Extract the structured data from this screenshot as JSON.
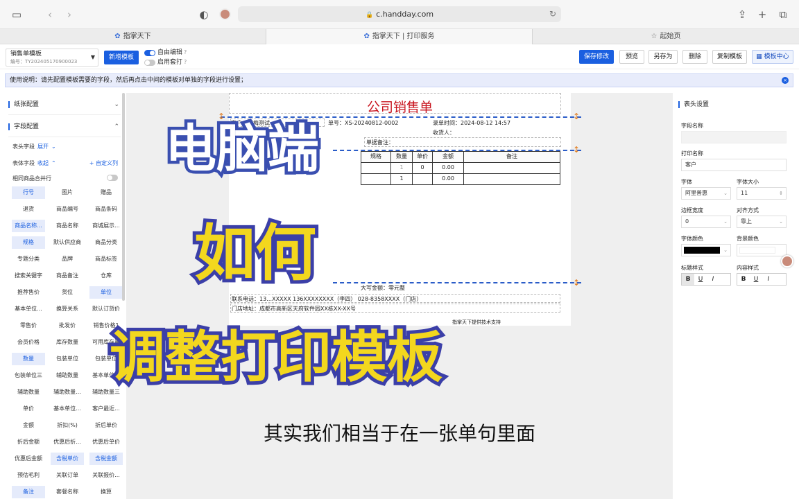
{
  "browser": {
    "url": "c.handday.com"
  },
  "tabs": [
    {
      "label": "指掌天下"
    },
    {
      "label": "指掌天下 | 打印服务"
    },
    {
      "label": "起始页"
    }
  ],
  "toolbar": {
    "template_name": "销售单模板",
    "template_code": "编号：TY202405170900023",
    "new_template": "新增模板",
    "free_edit": "自由编辑",
    "enable_set_print": "启用套打",
    "save": "保存修改",
    "preview": "预览",
    "save_as": "另存为",
    "delete": "删除",
    "copy": "复制模板",
    "center": "模板中心"
  },
  "notice": "使用说明：请先配置模板需要的字段，然后再点击中间的模板对单独的字段进行设置；",
  "left": {
    "paper_config": "纸张配置",
    "field_config": "字段配置",
    "header_fields": "表头字段",
    "expand": "展开",
    "table_fields": "表体字段",
    "collapse": "收起",
    "custom": "+ 自定义列",
    "merge_rows": "相同商品合并行",
    "chips": [
      [
        "行号",
        "图片",
        "赠品"
      ],
      [
        "退货",
        "商品编号",
        "商品条码"
      ],
      [
        "商品名称...",
        "商品名称",
        "商城展示..."
      ],
      [
        "规格",
        "默认供应商",
        "商品分类"
      ],
      [
        "专题分类",
        "品牌",
        "商品标签"
      ],
      [
        "搜索关键字",
        "商品备注",
        "仓库"
      ],
      [
        "推荐售价",
        "货位",
        "单位"
      ],
      [
        "基本单位...",
        "换算关系",
        "默认订货价"
      ],
      [
        "零售价",
        "批发价",
        "销售价格1"
      ],
      [
        "会员价格",
        "库存数量",
        "可用库存量"
      ],
      [
        "数量",
        "包装单位",
        "包装单位"
      ],
      [
        "包装单位三",
        "辅助数量",
        "基本单位..."
      ],
      [
        "辅助数量",
        "辅助数量...",
        "辅助数量三"
      ],
      [
        "单价",
        "基本单位...",
        "客户最近..."
      ],
      [
        "金额",
        "折扣(%)",
        "折后单价"
      ],
      [
        "折后金额",
        "优惠后折...",
        "优惠后单价"
      ],
      [
        "优惠后金额",
        "含税单价",
        "含税金额"
      ],
      [
        "预估毛利",
        "关联订单",
        "关联报价..."
      ],
      [
        "备注",
        "套餐名称",
        "换算"
      ]
    ],
    "selected": [
      [
        0,
        0
      ],
      [
        2,
        0
      ],
      [
        3,
        0
      ],
      [
        6,
        2
      ],
      [
        10,
        0
      ],
      [
        16,
        1
      ],
      [
        16,
        2
      ],
      [
        18,
        0
      ]
    ]
  },
  "paper": {
    "title": "公司销售单",
    "customer": "客户：红梅测试",
    "order_no": "单号：XS-20240812-0002",
    "order_time": "录单时间：2024-08-12 14:57",
    "receiver_phone": "收货电话：",
    "receiver": "收货人：",
    "remark": "单据备注：",
    "table_headers": [
      "规格",
      "数量",
      "单价",
      "金额",
      "备注"
    ],
    "row1": [
      "",
      "1",
      "0",
      "0.00",
      ""
    ],
    "row2": [
      "",
      "1",
      "",
      "0.00",
      ""
    ],
    "total_label": "大写金额：零元整",
    "contact": "联系电话：13…XXXXX  136XXXXXXXX（李四）  028-8358XXXX（门店）",
    "address": "门店地址：成都市高新区天府软件园XX栋XX-XX号",
    "footer": "指掌天下提供技术支持"
  },
  "right": {
    "section": "表头设置",
    "field_name": "字段名称",
    "print_name": "打印名称",
    "print_name_value": "客户",
    "font": "字体",
    "font_value": "阿里普惠",
    "font_size": "字体大小",
    "font_size_value": "11",
    "border_width": "边框宽度",
    "border_value": "0",
    "align": "对齐方式",
    "align_value": "靠上",
    "font_color": "字体颜色",
    "bg_color": "背景颜色",
    "title_style": "标题样式",
    "content_style": "内容样式",
    "style_buttons": [
      "B",
      "U",
      "I"
    ]
  },
  "overlay": {
    "line1": "电脑端",
    "line2": "如何",
    "line3": "调整打印模板",
    "subtitle": "其实我们相当于在一张单句里面"
  },
  "colors": {
    "accent": "#1a5fe0",
    "title_red": "#c8141e",
    "overlay_yellow": "#f3d71e",
    "overlay_blue": "#3b3fa8"
  }
}
